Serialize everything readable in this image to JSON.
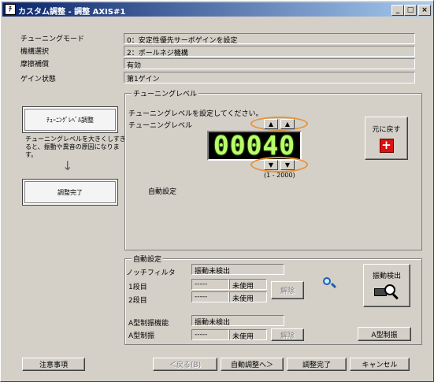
{
  "window": {
    "title": "カスタム調整 - 調整 AXIS#1",
    "icon_text": "ﾁ",
    "controls": {
      "minimize": "_",
      "maximize": "□",
      "close": "×"
    }
  },
  "status": {
    "tuning_mode_label": "チューニングモード",
    "tuning_mode_value": "0：安定性優先サーボゲインを設定",
    "mechanism_label": "機構選択",
    "mechanism_value": "2：ボールネジ機構",
    "friction_label": "摩擦補償",
    "friction_value": "有効",
    "gain_label": "ゲイン状態",
    "gain_value": "第1ゲイン"
  },
  "flow": {
    "step1": "ﾁｭｰﾆﾝｸﾞﾚﾍﾞﾙ調整",
    "note": "チューニングレベルを大きくしすぎると、振動や異音の原因になります。",
    "arrow": "↓",
    "step2": "調整完了"
  },
  "tuning_level": {
    "group_title": "チューニングレベル",
    "instruction": "チューニングレベルを設定してください。",
    "label": "チューニングレベル",
    "value": "00040",
    "range": "(1 - 2000)",
    "up_arrow": "▲",
    "down_arrow": "▼",
    "auto_setting": "自動設定",
    "reset_button": "元に戻す",
    "reset_icon": "+"
  },
  "auto_setting": {
    "group_title": "自動設定",
    "notch_label": "ノッチフィルタ",
    "notch_status": "振動未検出",
    "stage1_label": "1段目",
    "stage1_value": "-----",
    "stage1_state": "未使用",
    "stage2_label": "2段目",
    "stage2_value": "-----",
    "stage2_state": "未使用",
    "release_button": "解除",
    "a_type_label": "A型制振機能",
    "a_type_status": "振動未検出",
    "a_type_damp_label": "A型制振",
    "a_type_damp_value": "-----",
    "a_type_damp_state": "未使用",
    "a_release_button": "解除",
    "vibration_detect_button": "振動検出",
    "a_type_button": "A型制振"
  },
  "footer": {
    "notes_button": "注意事項",
    "back_button": "＜戻る(B)",
    "auto_adjust_button": "自動調整へ＞",
    "complete_button": "調整完了",
    "cancel_button": "キャンセル"
  },
  "colors": {
    "title_start": "#0a246a",
    "title_end": "#a6caf0",
    "lcd_text": "#b8ff6a",
    "highlight_oval": "#e8943a",
    "reset_icon": "#d11"
  }
}
